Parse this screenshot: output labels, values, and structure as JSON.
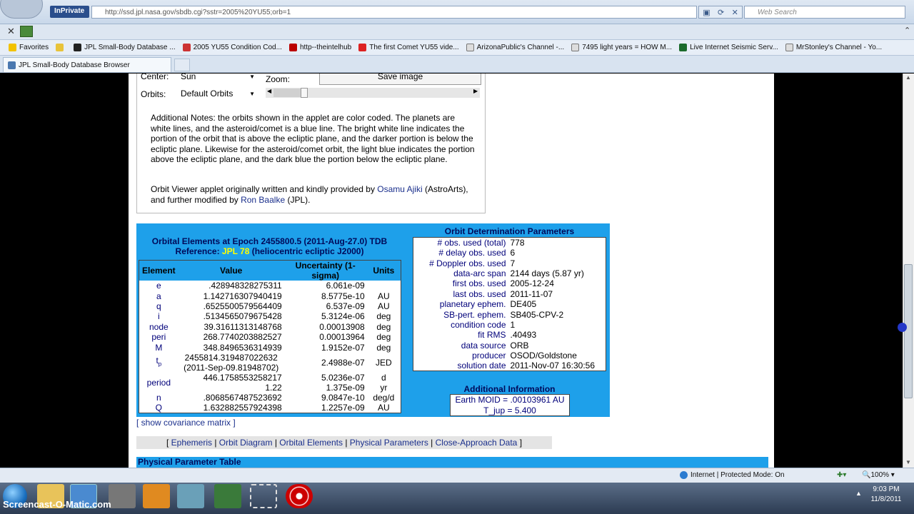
{
  "browser": {
    "inprivate": "InPrivate",
    "url": "http://ssd.jpl.nasa.gov/sbdb.cgi?sstr=2005%20YU55;orb=1",
    "search_placeholder": "Web Search",
    "tab_title": "JPL Small-Body Database Browser",
    "favorites_label": "Favorites",
    "favorites": [
      {
        "label": "JPL Small-Body Database ..."
      },
      {
        "label": "2005 YU55 Condition Cod..."
      },
      {
        "label": "http--theintelhub"
      },
      {
        "label": "The first Comet YU55 vide..."
      },
      {
        "label": "ArizonaPublic's Channel -..."
      },
      {
        "label": "7495 light years = HOW M..."
      },
      {
        "label": "Live Internet Seismic Serv..."
      },
      {
        "label": "MrStonley's Channel - Yo..."
      }
    ]
  },
  "applet": {
    "center_label": "Center:",
    "center_value": "Sun",
    "orbits_label": "Orbits:",
    "orbits_value": "Default Orbits",
    "zoom_label": "Zoom:",
    "save_image": "Save image",
    "notes": "Additional Notes: the orbits shown in the applet are color coded. The planets are white lines, and the asteroid/comet is a blue line. The bright white line indicates the portion of the orbit that is above the ecliptic plane, and the darker portion is below the ecliptic plane. Likewise for the asteroid/comet orbit, the light blue indicates the portion above the ecliptic plane, and the dark blue the portion below the ecliptic plane.",
    "credit_pre": "Orbit Viewer applet originally written and kindly provided by ",
    "credit_link1": "Osamu Ajiki",
    "credit_mid": " (AstroArts), and further modified by ",
    "credit_link2": "Ron Baalke",
    "credit_post": " (JPL)."
  },
  "orbital": {
    "title": "Orbital Elements at Epoch 2455800.5 (2011-Aug-27.0) TDB",
    "ref_pre": "Reference: ",
    "ref_link": "JPL 78",
    "ref_post": " (heliocentric ecliptic J2000)",
    "headers": [
      "Element",
      "Value",
      "Uncertainty (1-sigma)",
      "Units"
    ],
    "rows": [
      {
        "el": "e",
        "val": ".428948328275311",
        "unc": "6.061e-09",
        "units": ""
      },
      {
        "el": "a",
        "val": "1.142716307940419",
        "unc": "8.5775e-10",
        "units": "AU"
      },
      {
        "el": "q",
        "val": ".6525500579564409",
        "unc": "6.537e-09",
        "units": "AU"
      },
      {
        "el": "i",
        "val": ".5134565079675428",
        "unc": "5.3124e-06",
        "units": "deg"
      },
      {
        "el": "node",
        "val": "39.31611313148768",
        "unc": "0.00013908",
        "units": "deg"
      },
      {
        "el": "peri",
        "val": "268.7740203882527",
        "unc": "0.00013964",
        "units": "deg"
      },
      {
        "el": "M",
        "val": "348.8496536314939",
        "unc": "1.9152e-07",
        "units": "deg"
      }
    ],
    "tp": {
      "el": "t",
      "sub": "p",
      "val1": "2455814.319487022632",
      "val2": "(2011-Sep-09.81948702)",
      "unc": "2.4988e-07",
      "units": "JED"
    },
    "period": {
      "el": "period",
      "val1": "446.1758553258217",
      "val2": "1.22",
      "unc1": "5.0236e-07",
      "unc2": "1.375e-09",
      "units1": "d",
      "units2": "yr"
    },
    "rows2": [
      {
        "el": "n",
        "val": ".8068567487523692",
        "unc": "9.0847e-10",
        "units": "deg/d"
      },
      {
        "el": "Q",
        "val": "1.632882557924398",
        "unc": "1.2257e-09",
        "units": "AU"
      }
    ]
  },
  "determination": {
    "title": "Orbit Determination Parameters",
    "rows": [
      {
        "k": "# obs. used (total)",
        "v": "778"
      },
      {
        "k": "# delay obs. used",
        "v": "6"
      },
      {
        "k": "# Doppler obs. used",
        "v": "7"
      },
      {
        "k": "data-arc span",
        "v": "2144 days (5.87 yr)"
      },
      {
        "k": "first obs. used",
        "v": "2005-12-24"
      },
      {
        "k": "last obs. used",
        "v": "2011-11-07"
      },
      {
        "k": "planetary ephem.",
        "v": "DE405"
      },
      {
        "k": "SB-pert. ephem.",
        "v": "SB405-CPV-2"
      },
      {
        "k": "condition code",
        "v": "1"
      },
      {
        "k": "fit RMS",
        "v": ".40493"
      },
      {
        "k": "data source",
        "v": "ORB"
      },
      {
        "k": "producer",
        "v": "OSOD/Goldstone"
      },
      {
        "k": "solution date",
        "v": "2011-Nov-07 16:30:56"
      }
    ]
  },
  "additional": {
    "title": "Additional Information",
    "moid": "Earth MOID = .00103961 AU",
    "tjup": "T_jup = 5.400"
  },
  "links": {
    "covariance": "[ show covariance matrix ]",
    "open": "[ ",
    "close": " ]",
    "sep": " | ",
    "items": [
      "Ephemeris",
      "Orbit Diagram",
      "Orbital Elements",
      "Physical Parameters",
      "Close-Approach Data"
    ]
  },
  "physical_title": "Physical Parameter Table",
  "status": {
    "zone": "Internet | Protected Mode: On",
    "zoom": "100%"
  },
  "taskbar": {
    "watermark": "Screencast-O-Matic.com",
    "time": "9:03 PM",
    "date": "11/8/2011"
  },
  "colors": {
    "panel_blue": "#1ea0ea",
    "link_navy": "#1a2f8c",
    "reference_yellow": "#ffff00"
  }
}
